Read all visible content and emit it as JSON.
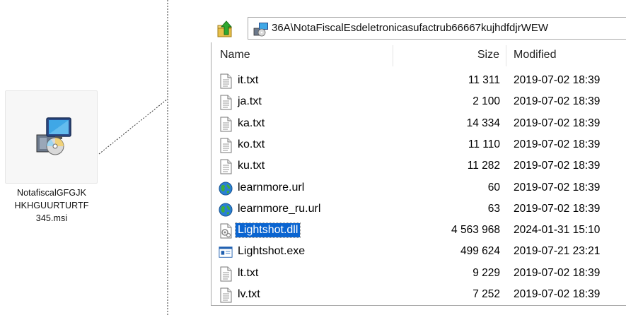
{
  "desktop_file": {
    "label_lines": [
      "NotafiscalGFGJK",
      "HKHGUURTURTF",
      "345.msi"
    ]
  },
  "address_bar": {
    "path": "36A\\NotaFiscalEsdeletronicasufactrub66667kujhdfdjrWEW"
  },
  "columns": {
    "name": "Name",
    "size": "Size",
    "modified": "Modified"
  },
  "files": [
    {
      "name": "it.txt",
      "size": "11 311",
      "modified": "2019-07-02 18:39",
      "icon": "text-file-icon"
    },
    {
      "name": "ja.txt",
      "size": "2 100",
      "modified": "2019-07-02 18:39",
      "icon": "text-file-icon"
    },
    {
      "name": "ka.txt",
      "size": "14 334",
      "modified": "2019-07-02 18:39",
      "icon": "text-file-icon"
    },
    {
      "name": "ko.txt",
      "size": "11 110",
      "modified": "2019-07-02 18:39",
      "icon": "text-file-icon"
    },
    {
      "name": "ku.txt",
      "size": "11 282",
      "modified": "2019-07-02 18:39",
      "icon": "text-file-icon"
    },
    {
      "name": "learnmore.url",
      "size": "60",
      "modified": "2019-07-02 18:39",
      "icon": "globe-icon"
    },
    {
      "name": "learnmore_ru.url",
      "size": "63",
      "modified": "2019-07-02 18:39",
      "icon": "globe-icon"
    },
    {
      "name": "Lightshot.dll",
      "size": "4 563 968",
      "modified": "2024-01-31 15:10",
      "icon": "dll-file-icon",
      "selected": true
    },
    {
      "name": "Lightshot.exe",
      "size": "499 624",
      "modified": "2019-07-21 23:21",
      "icon": "exe-file-icon"
    },
    {
      "name": "lt.txt",
      "size": "9 229",
      "modified": "2019-07-02 18:39",
      "icon": "text-file-icon"
    },
    {
      "name": "lv.txt",
      "size": "7 252",
      "modified": "2019-07-02 18:39",
      "icon": "text-file-icon"
    }
  ],
  "colors": {
    "selection": "#0a64d0",
    "border": "#a9a9a9"
  }
}
